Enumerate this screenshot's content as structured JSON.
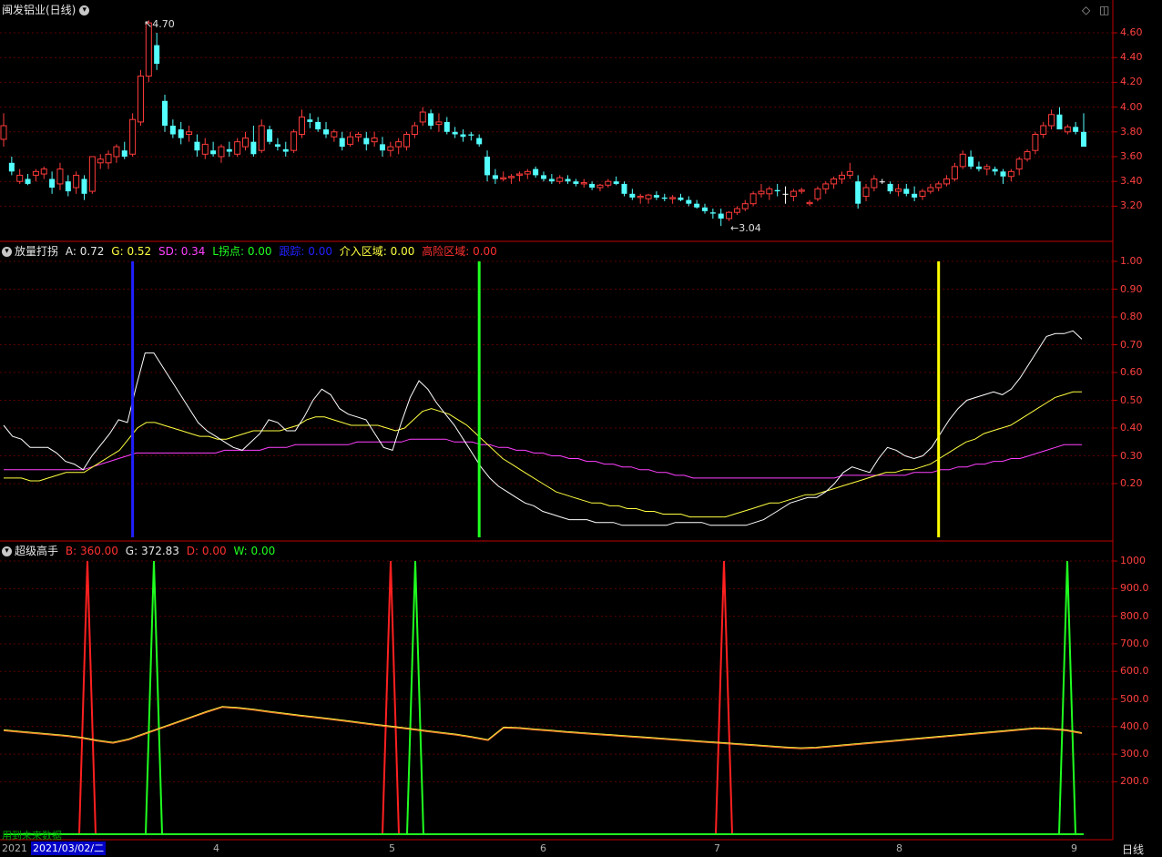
{
  "colors": {
    "up": "#ff3b3b",
    "down": "#54ffff",
    "flat": "#ffffff",
    "axis": "#c00000",
    "grid": "#5a0000",
    "white_line": "#ffffff",
    "yellow_line": "#ffff40",
    "magenta_line": "#ff40ff",
    "blue_bar": "#2020ff",
    "green_bar": "#20ff20",
    "yellow_bar": "#ffff00",
    "red_peak": "#ff2020",
    "green_peak": "#20ff20"
  },
  "main_panel": {
    "title": "闽发铝业(日线)",
    "high_label": "4.70",
    "low_label": "3.04",
    "y_ticks": [
      "4.60",
      "4.40",
      "4.20",
      "4.00",
      "3.80",
      "3.60",
      "3.40",
      "3.20"
    ]
  },
  "indicator_panel": {
    "name": "放量打拐",
    "A_label": "A:",
    "A_value": "0.72",
    "G_label": "G:",
    "G_value": "0.52",
    "SD_label": "SD:",
    "SD_value": "0.34",
    "L_label": "L拐点:",
    "L_value": "0.00",
    "track_label": "跟踪:",
    "track_value": "0.00",
    "entry_label": "介入区域:",
    "entry_value": "0.00",
    "risk_label": "高险区域:",
    "risk_value": "0.00",
    "y_ticks": [
      "1.00",
      "0.90",
      "0.80",
      "0.70",
      "0.60",
      "0.50",
      "0.40",
      "0.30",
      "0.20"
    ]
  },
  "super_panel": {
    "name": "超级高手",
    "B_label": "B:",
    "B_value": "360.00",
    "G_label": "G:",
    "G_value": "372.83",
    "D_label": "D:",
    "D_value": "0.00",
    "W_label": "W:",
    "W_value": "0.00",
    "y_ticks": [
      "1000",
      "900.0",
      "800.0",
      "700.0",
      "600.0",
      "500.0",
      "400.0",
      "300.0",
      "200.0"
    ]
  },
  "x_axis": {
    "year_label": "2021",
    "cursor_date": "2021/03/02/二",
    "months": [
      "4",
      "5",
      "6",
      "7",
      "8",
      "9"
    ],
    "period": "日线"
  },
  "footer_note": "用到未来数据",
  "chart_data": {
    "type": "candlestick",
    "ylim": [
      3.04,
      4.7
    ],
    "ohlc": [
      [
        3.74,
        3.95,
        3.68,
        3.85
      ],
      [
        3.55,
        3.6,
        3.45,
        3.48
      ],
      [
        3.4,
        3.5,
        3.38,
        3.45
      ],
      [
        3.42,
        3.46,
        3.37,
        3.38
      ],
      [
        3.45,
        3.5,
        3.4,
        3.48
      ],
      [
        3.46,
        3.52,
        3.42,
        3.5
      ],
      [
        3.42,
        3.48,
        3.3,
        3.35
      ],
      [
        3.38,
        3.55,
        3.33,
        3.5
      ],
      [
        3.4,
        3.45,
        3.28,
        3.32
      ],
      [
        3.35,
        3.48,
        3.3,
        3.45
      ],
      [
        3.42,
        3.45,
        3.25,
        3.3
      ],
      [
        3.32,
        3.6,
        3.3,
        3.6
      ],
      [
        3.55,
        3.62,
        3.5,
        3.58
      ],
      [
        3.55,
        3.65,
        3.5,
        3.62
      ],
      [
        3.6,
        3.7,
        3.55,
        3.68
      ],
      [
        3.65,
        3.72,
        3.58,
        3.6
      ],
      [
        3.62,
        3.95,
        3.6,
        3.9
      ],
      [
        3.88,
        4.3,
        3.85,
        4.25
      ],
      [
        4.25,
        4.7,
        4.2,
        4.68
      ],
      [
        4.5,
        4.6,
        4.3,
        4.35
      ],
      [
        4.05,
        4.1,
        3.8,
        3.85
      ],
      [
        3.85,
        3.9,
        3.75,
        3.78
      ],
      [
        3.82,
        3.88,
        3.7,
        3.75
      ],
      [
        3.78,
        3.85,
        3.72,
        3.8
      ],
      [
        3.72,
        3.78,
        3.6,
        3.65
      ],
      [
        3.62,
        3.75,
        3.58,
        3.7
      ],
      [
        3.65,
        3.72,
        3.6,
        3.62
      ],
      [
        3.6,
        3.7,
        3.55,
        3.68
      ],
      [
        3.66,
        3.72,
        3.6,
        3.64
      ],
      [
        3.62,
        3.75,
        3.6,
        3.72
      ],
      [
        3.68,
        3.8,
        3.65,
        3.75
      ],
      [
        3.72,
        3.85,
        3.6,
        3.62
      ],
      [
        3.65,
        3.9,
        3.63,
        3.85
      ],
      [
        3.82,
        3.85,
        3.7,
        3.72
      ],
      [
        3.7,
        3.75,
        3.65,
        3.68
      ],
      [
        3.66,
        3.72,
        3.6,
        3.64
      ],
      [
        3.65,
        3.82,
        3.63,
        3.8
      ],
      [
        3.78,
        3.98,
        3.75,
        3.92
      ],
      [
        3.9,
        3.95,
        3.83,
        3.88
      ],
      [
        3.88,
        3.92,
        3.8,
        3.82
      ],
      [
        3.82,
        3.88,
        3.75,
        3.78
      ],
      [
        3.76,
        3.82,
        3.72,
        3.8
      ],
      [
        3.75,
        3.8,
        3.65,
        3.68
      ],
      [
        3.7,
        3.8,
        3.68,
        3.76
      ],
      [
        3.76,
        3.8,
        3.72,
        3.78
      ],
      [
        3.75,
        3.8,
        3.65,
        3.7
      ],
      [
        3.72,
        3.8,
        3.68,
        3.75
      ],
      [
        3.7,
        3.76,
        3.6,
        3.65
      ],
      [
        3.65,
        3.72,
        3.6,
        3.68
      ],
      [
        3.68,
        3.75,
        3.62,
        3.72
      ],
      [
        3.68,
        3.8,
        3.65,
        3.78
      ],
      [
        3.78,
        3.88,
        3.75,
        3.85
      ],
      [
        3.88,
        4.0,
        3.85,
        3.96
      ],
      [
        3.95,
        3.98,
        3.82,
        3.85
      ],
      [
        3.86,
        3.95,
        3.8,
        3.88
      ],
      [
        3.88,
        3.92,
        3.78,
        3.8
      ],
      [
        3.8,
        3.84,
        3.75,
        3.78
      ],
      [
        3.78,
        3.82,
        3.72,
        3.76
      ],
      [
        3.78,
        3.8,
        3.73,
        3.77
      ],
      [
        3.75,
        3.78,
        3.68,
        3.7
      ],
      [
        3.6,
        3.65,
        3.4,
        3.45
      ],
      [
        3.45,
        3.5,
        3.38,
        3.42
      ],
      [
        3.42,
        3.48,
        3.4,
        3.43
      ],
      [
        3.43,
        3.46,
        3.38,
        3.44
      ],
      [
        3.45,
        3.48,
        3.4,
        3.46
      ],
      [
        3.46,
        3.5,
        3.42,
        3.48
      ],
      [
        3.5,
        3.52,
        3.43,
        3.45
      ],
      [
        3.45,
        3.48,
        3.4,
        3.42
      ],
      [
        3.42,
        3.46,
        3.38,
        3.4
      ],
      [
        3.4,
        3.45,
        3.38,
        3.43
      ],
      [
        3.42,
        3.45,
        3.38,
        3.4
      ],
      [
        3.4,
        3.42,
        3.36,
        3.38
      ],
      [
        3.38,
        3.42,
        3.35,
        3.39
      ],
      [
        3.38,
        3.4,
        3.33,
        3.35
      ],
      [
        3.35,
        3.38,
        3.32,
        3.37
      ],
      [
        3.37,
        3.42,
        3.35,
        3.4
      ],
      [
        3.4,
        3.44,
        3.37,
        3.38
      ],
      [
        3.38,
        3.4,
        3.28,
        3.3
      ],
      [
        3.3,
        3.34,
        3.25,
        3.27
      ],
      [
        3.27,
        3.3,
        3.22,
        3.28
      ],
      [
        3.26,
        3.3,
        3.22,
        3.29
      ],
      [
        3.29,
        3.32,
        3.25,
        3.27
      ],
      [
        3.27,
        3.3,
        3.24,
        3.26
      ],
      [
        3.26,
        3.29,
        3.22,
        3.27
      ],
      [
        3.27,
        3.3,
        3.24,
        3.25
      ],
      [
        3.25,
        3.28,
        3.2,
        3.22
      ],
      [
        3.22,
        3.25,
        3.18,
        3.19
      ],
      [
        3.19,
        3.22,
        3.14,
        3.16
      ],
      [
        3.15,
        3.18,
        3.1,
        3.14
      ],
      [
        3.14,
        3.18,
        3.04,
        3.1
      ],
      [
        3.1,
        3.16,
        3.08,
        3.15
      ],
      [
        3.15,
        3.2,
        3.13,
        3.18
      ],
      [
        3.18,
        3.25,
        3.16,
        3.22
      ],
      [
        3.22,
        3.32,
        3.2,
        3.3
      ],
      [
        3.3,
        3.38,
        3.27,
        3.32
      ],
      [
        3.3,
        3.36,
        3.25,
        3.34
      ],
      [
        3.33,
        3.38,
        3.28,
        3.32
      ],
      [
        3.3,
        3.36,
        3.22,
        3.3
      ],
      [
        3.28,
        3.34,
        3.24,
        3.32
      ],
      [
        3.32,
        3.35,
        3.3,
        3.33
      ],
      [
        3.22,
        3.25,
        3.2,
        3.23
      ],
      [
        3.26,
        3.36,
        3.24,
        3.34
      ],
      [
        3.34,
        3.4,
        3.3,
        3.38
      ],
      [
        3.38,
        3.44,
        3.34,
        3.42
      ],
      [
        3.42,
        3.48,
        3.38,
        3.45
      ],
      [
        3.45,
        3.55,
        3.42,
        3.48
      ],
      [
        3.4,
        3.45,
        3.18,
        3.22
      ],
      [
        3.28,
        3.38,
        3.24,
        3.35
      ],
      [
        3.35,
        3.45,
        3.32,
        3.42
      ],
      [
        3.4,
        3.42,
        3.38,
        3.4
      ],
      [
        3.38,
        3.4,
        3.3,
        3.32
      ],
      [
        3.32,
        3.38,
        3.28,
        3.34
      ],
      [
        3.34,
        3.38,
        3.28,
        3.3
      ],
      [
        3.3,
        3.36,
        3.24,
        3.27
      ],
      [
        3.28,
        3.34,
        3.25,
        3.32
      ],
      [
        3.32,
        3.38,
        3.3,
        3.35
      ],
      [
        3.35,
        3.4,
        3.32,
        3.38
      ],
      [
        3.38,
        3.45,
        3.36,
        3.42
      ],
      [
        3.42,
        3.55,
        3.4,
        3.52
      ],
      [
        3.52,
        3.65,
        3.5,
        3.62
      ],
      [
        3.6,
        3.65,
        3.5,
        3.52
      ],
      [
        3.52,
        3.56,
        3.48,
        3.5
      ],
      [
        3.5,
        3.54,
        3.45,
        3.52
      ],
      [
        3.5,
        3.52,
        3.45,
        3.48
      ],
      [
        3.48,
        3.5,
        3.38,
        3.44
      ],
      [
        3.44,
        3.5,
        3.4,
        3.48
      ],
      [
        3.5,
        3.6,
        3.45,
        3.58
      ],
      [
        3.58,
        3.66,
        3.56,
        3.64
      ],
      [
        3.65,
        3.8,
        3.62,
        3.78
      ],
      [
        3.78,
        3.88,
        3.75,
        3.85
      ],
      [
        3.85,
        3.98,
        3.82,
        3.94
      ],
      [
        3.94,
        4.0,
        3.88,
        3.82
      ],
      [
        3.8,
        3.86,
        3.78,
        3.84
      ],
      [
        3.84,
        3.88,
        3.78,
        3.8
      ],
      [
        3.8,
        3.95,
        3.7,
        3.68
      ]
    ],
    "lines": {
      "white": [
        0.41,
        0.37,
        0.36,
        0.33,
        0.33,
        0.33,
        0.31,
        0.28,
        0.27,
        0.25,
        0.3,
        0.34,
        0.38,
        0.43,
        0.42,
        0.55,
        0.67,
        0.67,
        0.62,
        0.57,
        0.52,
        0.47,
        0.42,
        0.39,
        0.37,
        0.35,
        0.33,
        0.32,
        0.35,
        0.38,
        0.43,
        0.42,
        0.39,
        0.39,
        0.44,
        0.5,
        0.54,
        0.52,
        0.47,
        0.45,
        0.44,
        0.43,
        0.38,
        0.33,
        0.32,
        0.42,
        0.51,
        0.57,
        0.54,
        0.49,
        0.45,
        0.41,
        0.36,
        0.31,
        0.26,
        0.22,
        0.19,
        0.17,
        0.15,
        0.13,
        0.12,
        0.1,
        0.09,
        0.08,
        0.07,
        0.07,
        0.07,
        0.06,
        0.06,
        0.06,
        0.05,
        0.05,
        0.05,
        0.05,
        0.05,
        0.05,
        0.06,
        0.06,
        0.06,
        0.06,
        0.05,
        0.05,
        0.05,
        0.05,
        0.05,
        0.06,
        0.07,
        0.09,
        0.11,
        0.13,
        0.14,
        0.15,
        0.15,
        0.17,
        0.2,
        0.24,
        0.26,
        0.25,
        0.24,
        0.29,
        0.33,
        0.32,
        0.3,
        0.29,
        0.3,
        0.33,
        0.38,
        0.43,
        0.47,
        0.5,
        0.51,
        0.52,
        0.53,
        0.52,
        0.54,
        0.58,
        0.63,
        0.68,
        0.73,
        0.74,
        0.74,
        0.75,
        0.72
      ],
      "yellow": [
        0.22,
        0.22,
        0.22,
        0.21,
        0.21,
        0.22,
        0.23,
        0.24,
        0.24,
        0.24,
        0.26,
        0.28,
        0.3,
        0.32,
        0.36,
        0.4,
        0.42,
        0.42,
        0.41,
        0.4,
        0.39,
        0.38,
        0.37,
        0.37,
        0.36,
        0.36,
        0.37,
        0.38,
        0.39,
        0.39,
        0.39,
        0.39,
        0.4,
        0.41,
        0.43,
        0.44,
        0.44,
        0.43,
        0.42,
        0.41,
        0.41,
        0.41,
        0.41,
        0.4,
        0.39,
        0.4,
        0.43,
        0.46,
        0.47,
        0.46,
        0.45,
        0.43,
        0.41,
        0.38,
        0.35,
        0.32,
        0.29,
        0.27,
        0.25,
        0.23,
        0.21,
        0.19,
        0.17,
        0.16,
        0.15,
        0.14,
        0.13,
        0.13,
        0.12,
        0.12,
        0.11,
        0.11,
        0.1,
        0.1,
        0.09,
        0.09,
        0.09,
        0.08,
        0.08,
        0.08,
        0.08,
        0.08,
        0.09,
        0.1,
        0.11,
        0.12,
        0.13,
        0.13,
        0.14,
        0.15,
        0.16,
        0.16,
        0.17,
        0.18,
        0.19,
        0.2,
        0.21,
        0.22,
        0.23,
        0.24,
        0.24,
        0.25,
        0.25,
        0.26,
        0.27,
        0.29,
        0.31,
        0.33,
        0.35,
        0.36,
        0.38,
        0.39,
        0.4,
        0.41,
        0.43,
        0.45,
        0.47,
        0.49,
        0.51,
        0.52,
        0.53,
        0.53
      ],
      "magenta": [
        0.25,
        0.25,
        0.25,
        0.25,
        0.25,
        0.25,
        0.25,
        0.25,
        0.25,
        0.25,
        0.26,
        0.27,
        0.28,
        0.29,
        0.3,
        0.31,
        0.31,
        0.31,
        0.31,
        0.31,
        0.31,
        0.31,
        0.31,
        0.31,
        0.31,
        0.32,
        0.32,
        0.32,
        0.32,
        0.32,
        0.33,
        0.33,
        0.33,
        0.34,
        0.34,
        0.34,
        0.34,
        0.34,
        0.34,
        0.34,
        0.35,
        0.35,
        0.35,
        0.35,
        0.35,
        0.35,
        0.36,
        0.36,
        0.36,
        0.36,
        0.36,
        0.35,
        0.35,
        0.35,
        0.34,
        0.34,
        0.33,
        0.33,
        0.32,
        0.32,
        0.31,
        0.31,
        0.3,
        0.3,
        0.29,
        0.29,
        0.28,
        0.28,
        0.27,
        0.27,
        0.26,
        0.26,
        0.25,
        0.25,
        0.24,
        0.24,
        0.23,
        0.23,
        0.22,
        0.22,
        0.22,
        0.22,
        0.22,
        0.22,
        0.22,
        0.22,
        0.22,
        0.22,
        0.22,
        0.22,
        0.22,
        0.22,
        0.22,
        0.22,
        0.22,
        0.23,
        0.23,
        0.23,
        0.23,
        0.23,
        0.23,
        0.23,
        0.23,
        0.24,
        0.24,
        0.24,
        0.25,
        0.25,
        0.26,
        0.26,
        0.27,
        0.27,
        0.28,
        0.28,
        0.29,
        0.29,
        0.3,
        0.31,
        0.32,
        0.33,
        0.34,
        0.34,
        0.34
      ]
    },
    "signal_bars": [
      {
        "color": "blue_bar",
        "index": 16
      },
      {
        "color": "green_bar",
        "index": 59
      },
      {
        "color": "yellow_bar",
        "index": 116
      }
    ],
    "super_series": [
      385,
      380,
      375,
      370,
      365,
      358,
      348,
      340,
      352,
      372,
      392,
      412,
      432,
      452,
      470,
      466,
      460,
      452,
      445,
      438,
      432,
      425,
      418,
      411,
      404,
      397,
      390,
      383,
      376,
      369,
      360,
      350,
      395,
      393,
      388,
      384,
      379,
      375,
      371,
      367,
      363,
      359,
      355,
      351,
      347,
      343,
      339,
      335,
      331,
      327,
      323,
      320,
      322,
      327,
      332,
      337,
      342,
      347,
      352,
      357,
      362,
      367,
      372,
      377,
      382,
      387,
      392,
      390,
      385,
      375
    ],
    "peaks": [
      {
        "color": "red_peak",
        "x": 96
      },
      {
        "color": "green_peak",
        "x": 169
      },
      {
        "color": "red_peak",
        "x": 429
      },
      {
        "color": "green_peak",
        "x": 456
      },
      {
        "color": "red_peak",
        "x": 795
      },
      {
        "color": "green_peak",
        "x": 1172
      }
    ]
  }
}
